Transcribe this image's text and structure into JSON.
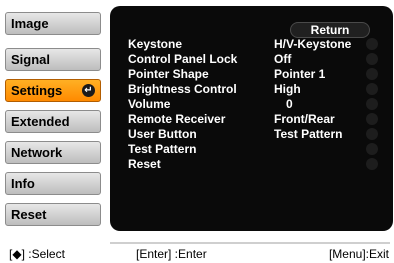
{
  "menu": {
    "items": [
      {
        "label": "Image"
      },
      {
        "label": "Signal"
      },
      {
        "label": "Settings",
        "active": true
      },
      {
        "label": "Extended"
      },
      {
        "label": "Network"
      },
      {
        "label": "Info"
      },
      {
        "label": "Reset"
      }
    ],
    "enter_icon": "↵"
  },
  "panel": {
    "return_label": "Return",
    "rows": [
      {
        "label": "Keystone",
        "value": "H/V-Keystone"
      },
      {
        "label": "Control Panel Lock",
        "value": "Off"
      },
      {
        "label": "Pointer Shape",
        "value": "Pointer 1"
      },
      {
        "label": "Brightness Control",
        "value": "High"
      },
      {
        "label": "Volume",
        "value": "0"
      },
      {
        "label": "Remote Receiver",
        "value": "Front/Rear"
      },
      {
        "label": "User Button",
        "value": "Test Pattern"
      },
      {
        "label": "Test Pattern",
        "value": ""
      },
      {
        "label": "Reset",
        "value": ""
      }
    ]
  },
  "footer": {
    "select_hint": "[◆] :Select",
    "enter_hint": "[Enter] :Enter",
    "exit_hint": "[Menu]:Exit"
  },
  "colors": {
    "active_menu": "#ff9a12",
    "panel_bg": "#0a0a0a",
    "menu_bg": "#d0d0d0"
  }
}
